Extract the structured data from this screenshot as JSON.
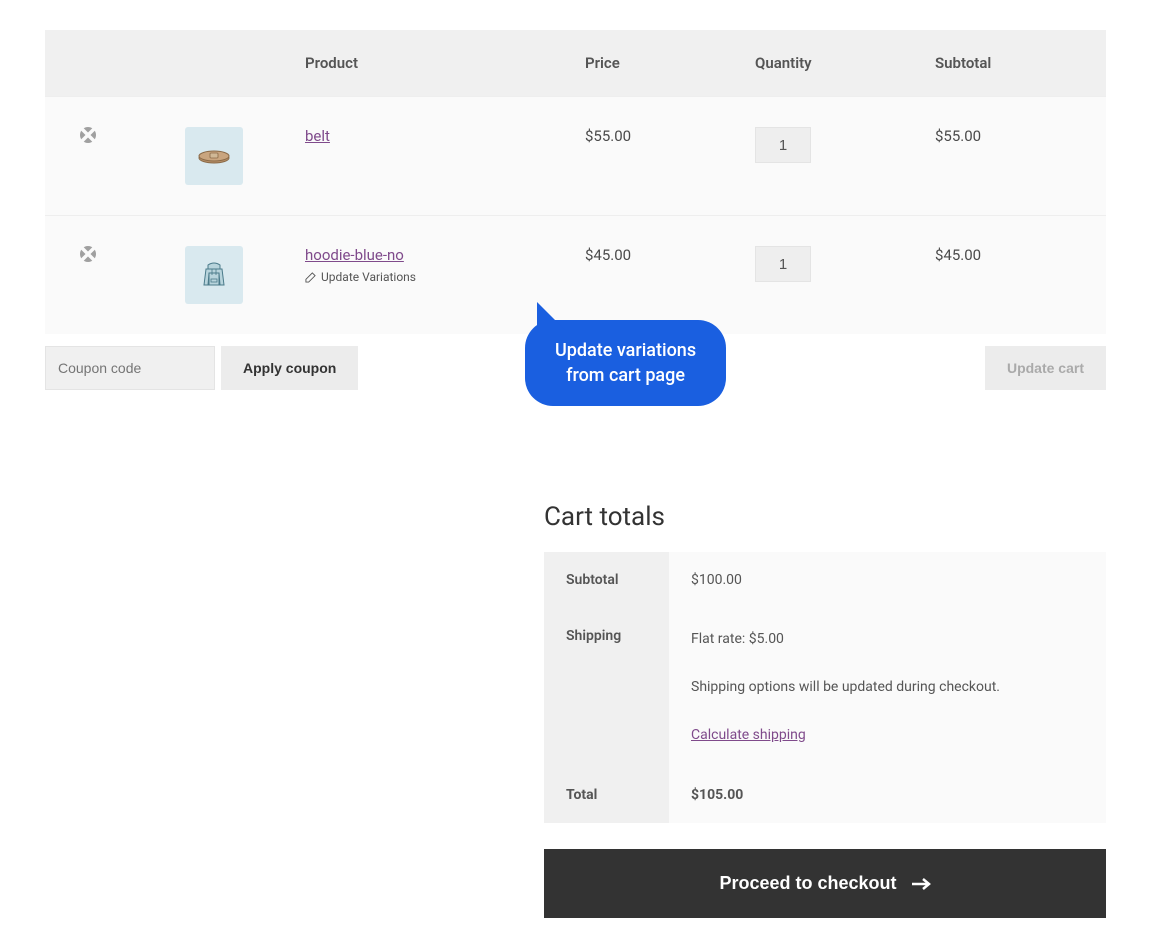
{
  "table": {
    "headers": {
      "product": "Product",
      "price": "Price",
      "quantity": "Quantity",
      "subtotal": "Subtotal"
    },
    "rows": [
      {
        "name": "belt",
        "price": "$55.00",
        "qty": "1",
        "subtotal": "$55.00",
        "has_variations": false
      },
      {
        "name": "hoodie-blue-no",
        "price": "$45.00",
        "qty": "1",
        "subtotal": "$45.00",
        "has_variations": true,
        "variation_label": "Update Variations"
      }
    ]
  },
  "coupon": {
    "placeholder": "Coupon code",
    "apply": "Apply coupon"
  },
  "update_cart": "Update cart",
  "tooltip": {
    "line1": "Update variations",
    "line2": "from cart page"
  },
  "totals": {
    "title": "Cart totals",
    "subtotal_label": "Subtotal",
    "subtotal_value": "$100.00",
    "shipping_label": "Shipping",
    "shipping_rate": "Flat rate: $5.00",
    "shipping_note": "Shipping options will be updated during checkout.",
    "calc_shipping": "Calculate shipping",
    "total_label": "Total",
    "total_value": "$105.00"
  },
  "checkout": "Proceed to checkout"
}
